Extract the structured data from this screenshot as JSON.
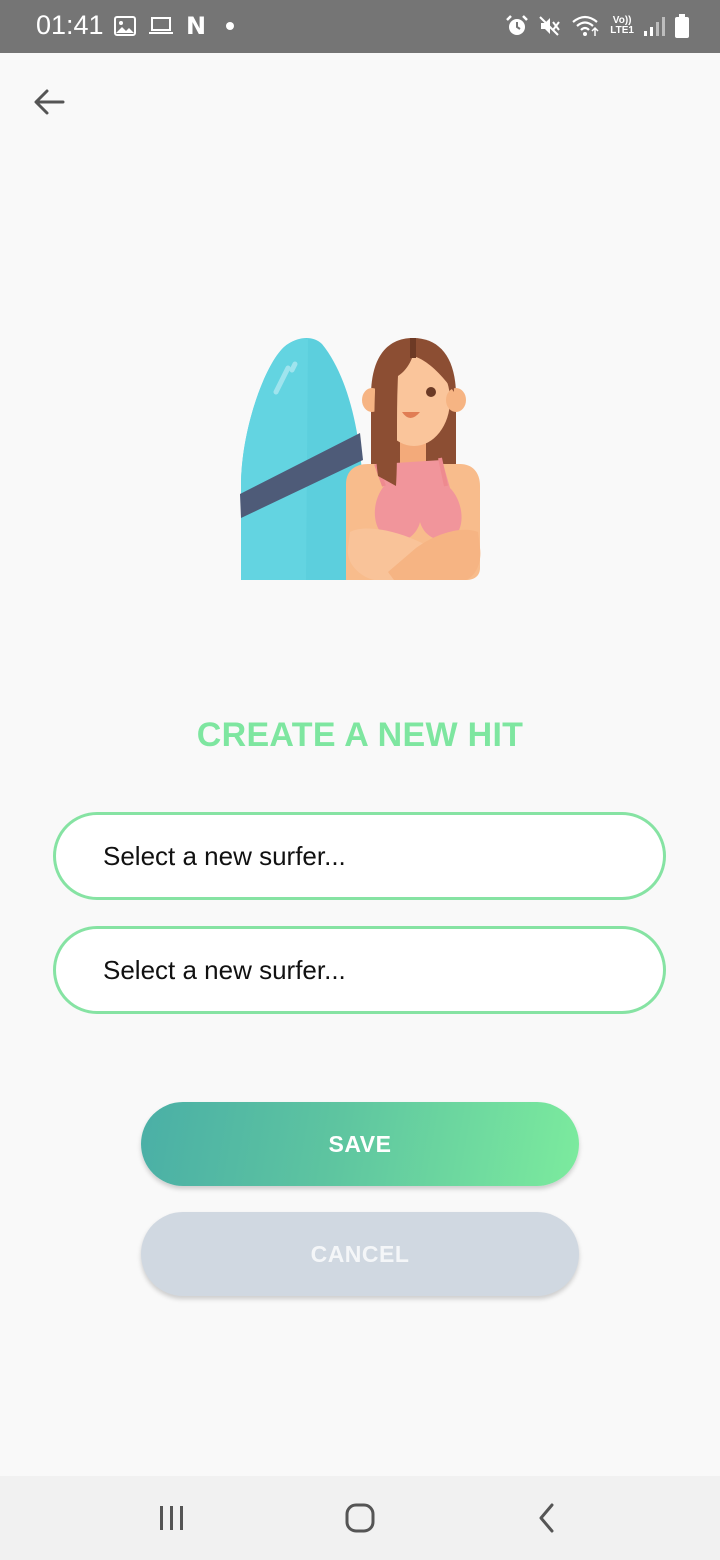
{
  "status_bar": {
    "time": "01:41",
    "left_icons": [
      "image-icon",
      "laptop-icon",
      "netflix-icon",
      "dot-icon"
    ],
    "netflix_letter": "N",
    "right_icons": [
      "alarm-icon",
      "mute-icon",
      "wifi-icon",
      "volte-icon",
      "signal-icon",
      "battery-icon"
    ],
    "volte_label": "Vo))",
    "lte_label": "LTE1"
  },
  "header": {
    "back_icon": "arrow-left-icon"
  },
  "illustration": {
    "icon": "surfer-girl-with-surfboard-icon"
  },
  "page_title": "CREATE A NEW HIT",
  "fields": [
    {
      "value": "Select a new surfer..."
    },
    {
      "value": "Select a new surfer..."
    }
  ],
  "buttons": {
    "save": "SAVE",
    "cancel": "CANCEL"
  },
  "nav_bar": {
    "icons": [
      "recent-apps-icon",
      "home-icon",
      "back-icon"
    ]
  },
  "colors": {
    "accent_green": "#7ee6a0",
    "field_border": "#86e3a3",
    "save_gradient_start": "#4aafa6",
    "save_gradient_end": "#7ceb9e",
    "cancel_bg": "#d0d8e1",
    "status_bar_bg": "#757575"
  }
}
